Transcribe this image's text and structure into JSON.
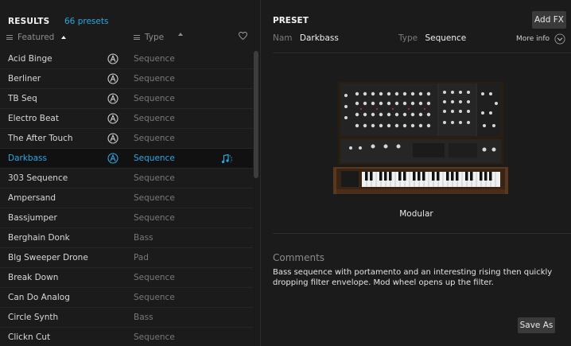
{
  "results": {
    "title": "RESULTS",
    "count": "66 presets",
    "col_featured": "Featured",
    "col_type": "Type",
    "rows": [
      {
        "name": "Acid Binge",
        "type": "Sequence",
        "arturia": true
      },
      {
        "name": "Berliner",
        "type": "Sequence",
        "arturia": true
      },
      {
        "name": "TB Seq",
        "type": "Sequence",
        "arturia": true
      },
      {
        "name": "Electro Beat",
        "type": "Sequence",
        "arturia": true
      },
      {
        "name": "The After Touch",
        "type": "Sequence",
        "arturia": true
      },
      {
        "name": "Darkbass",
        "type": "Sequence",
        "arturia": true,
        "selected": true
      },
      {
        "name": "303 Sequence",
        "type": "Sequence"
      },
      {
        "name": "Ampersand",
        "type": "Sequence"
      },
      {
        "name": "Bassjumper",
        "type": "Sequence"
      },
      {
        "name": "Berghain Donk",
        "type": "Bass"
      },
      {
        "name": "Blg Sweeper Drone",
        "type": "Pad"
      },
      {
        "name": "Break Down",
        "type": "Sequence"
      },
      {
        "name": "Can Do Analog",
        "type": "Sequence"
      },
      {
        "name": "Circle Synth",
        "type": "Bass"
      },
      {
        "name": "Clickn Cut",
        "type": "Sequence"
      }
    ]
  },
  "preset": {
    "title": "PRESET",
    "add_fx": "Add FX",
    "name_label": "Nam",
    "name_value": "Darkbass",
    "type_label": "Type",
    "type_value": "Sequence",
    "more_info": "More info",
    "model": "Modular",
    "comments_label": "Comments",
    "comments": "Bass sequence with portamento and an interesting rising then quickly dropping filter envelope. Mod wheel opens up the filter.",
    "save_as": "Save As"
  },
  "colors": {
    "accent": "#2ea7e0",
    "background": "#1b1b1b"
  }
}
